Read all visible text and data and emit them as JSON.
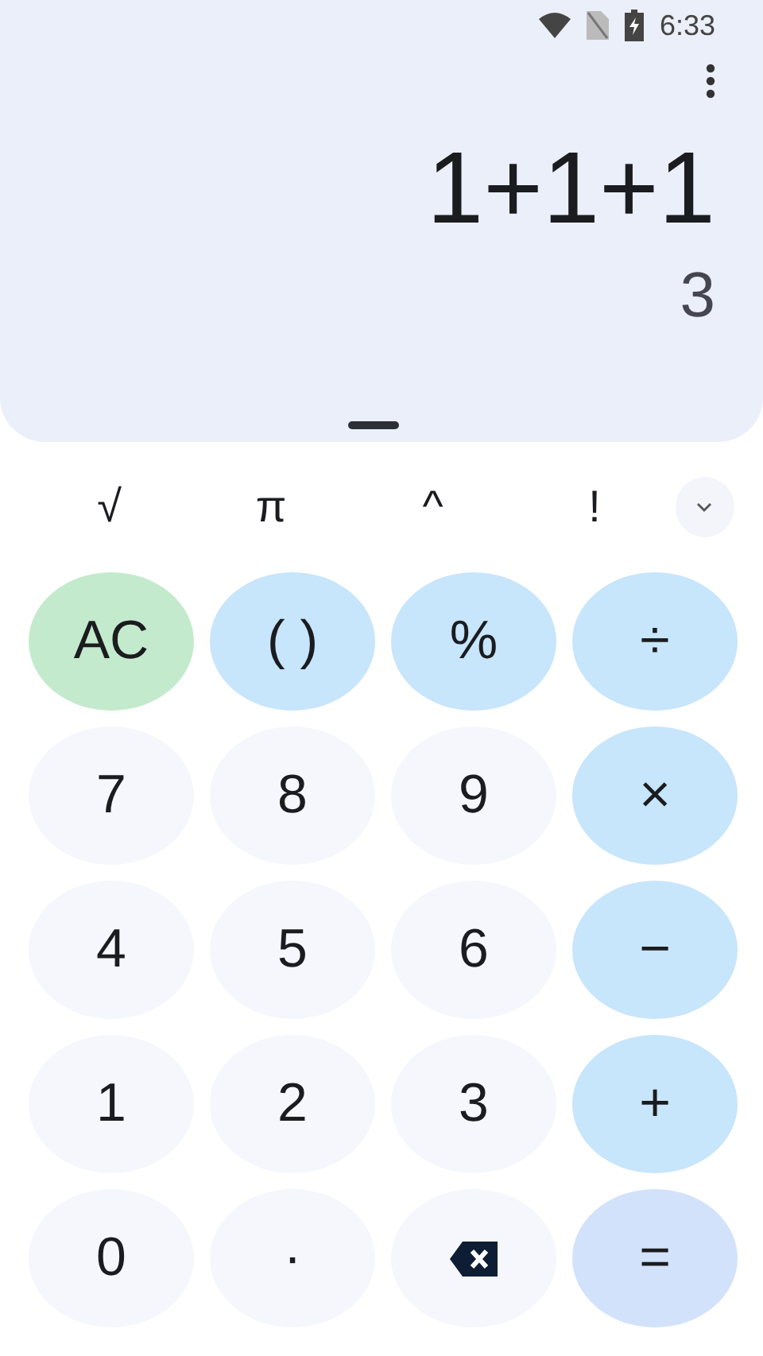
{
  "status_bar": {
    "time": "6:33"
  },
  "display": {
    "expression": "1+1+1",
    "result": "3"
  },
  "scientific_keys": [
    {
      "label": "√"
    },
    {
      "label": "π"
    },
    {
      "label": "^"
    },
    {
      "label": "!"
    }
  ],
  "expand_toggle": {
    "expanded": false
  },
  "keys": [
    {
      "kind": "clear",
      "label": "AC"
    },
    {
      "kind": "op",
      "label": "( )"
    },
    {
      "kind": "op",
      "label": "%"
    },
    {
      "kind": "op",
      "label": "÷"
    },
    {
      "kind": "digit",
      "label": "7"
    },
    {
      "kind": "digit",
      "label": "8"
    },
    {
      "kind": "digit",
      "label": "9"
    },
    {
      "kind": "op",
      "label": "×"
    },
    {
      "kind": "digit",
      "label": "4"
    },
    {
      "kind": "digit",
      "label": "5"
    },
    {
      "kind": "digit",
      "label": "6"
    },
    {
      "kind": "op",
      "label": "−"
    },
    {
      "kind": "digit",
      "label": "1"
    },
    {
      "kind": "digit",
      "label": "2"
    },
    {
      "kind": "digit",
      "label": "3"
    },
    {
      "kind": "op",
      "label": "+"
    },
    {
      "kind": "digit",
      "label": "0"
    },
    {
      "kind": "digit",
      "label": "·"
    },
    {
      "kind": "backspace"
    },
    {
      "kind": "equals",
      "label": "="
    }
  ]
}
